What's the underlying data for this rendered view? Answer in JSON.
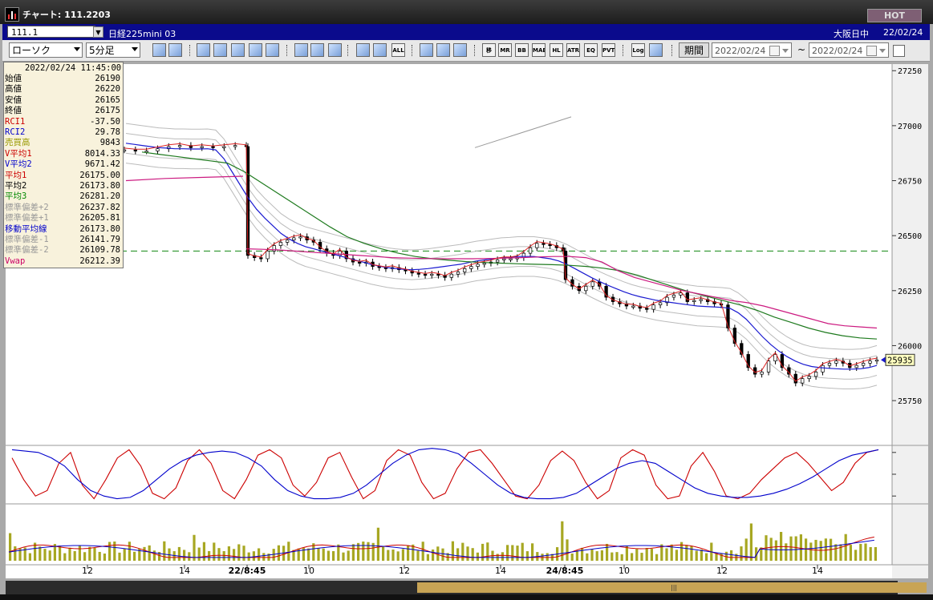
{
  "window": {
    "title": "チャート: 111.2203",
    "hot": "HOT"
  },
  "topbar": {
    "symbol_code": "111.1",
    "symbol_name": "日経225mini 03",
    "exchange": "大阪日中",
    "date": "22/02/24"
  },
  "toolbar": {
    "chart_type": "ローソク",
    "interval": "5分足",
    "period_label": "期間",
    "date_from": "2022/02/24",
    "date_to": "2022/02/24",
    "range_sep": "~",
    "buttons": [
      {
        "name": "zoom-button",
        "text": ""
      },
      {
        "name": "split-button",
        "text": ""
      },
      {
        "name": "arrow-down-button",
        "text": ""
      },
      {
        "name": "zoom-in-button",
        "text": ""
      },
      {
        "name": "bar-scale-button",
        "text": ""
      },
      {
        "name": "flip-button",
        "text": ""
      },
      {
        "name": "info-button",
        "text": ""
      },
      {
        "name": "pencil-button",
        "text": ""
      },
      {
        "name": "cursor-button",
        "text": ""
      },
      {
        "name": "undo-button",
        "text": ""
      },
      {
        "name": "candle-button",
        "text": ""
      },
      {
        "name": "candle-alt-button",
        "text": ""
      },
      {
        "name": "all-button",
        "text": "ALL"
      },
      {
        "name": "settings-button",
        "text": ""
      },
      {
        "name": "tool-button",
        "text": ""
      },
      {
        "name": "color-button",
        "text": ""
      },
      {
        "name": "ma-button",
        "text": "移"
      },
      {
        "name": "mr-button",
        "text": "MR"
      },
      {
        "name": "bb-button",
        "text": "BB"
      },
      {
        "name": "mae-button",
        "text": "MAE"
      },
      {
        "name": "hl-button",
        "text": "HL"
      },
      {
        "name": "atr-button",
        "text": "ATR"
      },
      {
        "name": "eq-button",
        "text": "EQ"
      },
      {
        "name": "pvt-button",
        "text": "PVT"
      },
      {
        "name": "log-button",
        "text": "Log"
      },
      {
        "name": "export-button",
        "text": ""
      }
    ]
  },
  "info_panel": {
    "datetime": "2022/02/24 11:45:00",
    "rows": [
      {
        "label": "始値",
        "value": "26190",
        "color": "#000000"
      },
      {
        "label": "高値",
        "value": "26220",
        "color": "#000000"
      },
      {
        "label": "安値",
        "value": "26165",
        "color": "#000000"
      },
      {
        "label": "終値",
        "value": "26175",
        "color": "#000000"
      },
      {
        "label": "RCI1",
        "value": "-37.50",
        "color": "#cc0000"
      },
      {
        "label": "RCI2",
        "value": "29.78",
        "color": "#0000cc"
      },
      {
        "label": "売買高",
        "value": "9843",
        "color": "#999900"
      },
      {
        "label": "V平均1",
        "value": "8014.33",
        "color": "#cc0000"
      },
      {
        "label": "V平均2",
        "value": "9671.42",
        "color": "#0000cc"
      },
      {
        "label": "平均1",
        "value": "26175.00",
        "color": "#cc0000"
      },
      {
        "label": "平均2",
        "value": "26173.80",
        "color": "#000000"
      },
      {
        "label": "平均3",
        "value": "26281.20",
        "color": "#008800"
      },
      {
        "label": "標準偏差+2",
        "value": "26237.82",
        "color": "#999999"
      },
      {
        "label": "標準偏差+1",
        "value": "26205.81",
        "color": "#999999"
      },
      {
        "label": "移動平均線",
        "value": "26173.80",
        "color": "#0000cc"
      },
      {
        "label": "標準偏差-1",
        "value": "26141.79",
        "color": "#999999"
      },
      {
        "label": "標準偏差-2",
        "value": "26109.78",
        "color": "#999999"
      },
      {
        "label": "Vwap",
        "value": "26212.39",
        "color": "#cc0066"
      }
    ]
  },
  "chart_data": {
    "type": "candlestick",
    "price_axis": {
      "ticks": [
        27250,
        27000,
        26750,
        26500,
        26250,
        26000,
        25750
      ],
      "ylim": [
        25550,
        27280
      ]
    },
    "x_ticks": [
      "12",
      "14",
      "22/8:45",
      "10",
      "12",
      "14",
      "24/8:45",
      "10",
      "12",
      "14"
    ],
    "current_price": "25935",
    "dashed_line": 26430,
    "trendline": [
      [
        26900,
        26945
      ],
      [
        27040,
        27200
      ]
    ],
    "candles_close": [
      26890,
      26885,
      26885,
      26895,
      26905,
      26910,
      26900,
      26905,
      26900,
      26905,
      26910,
      26905,
      26410,
      26400,
      26395,
      26430,
      26455,
      26470,
      26480,
      26490,
      26495,
      26480,
      26470,
      26440,
      26420,
      26410,
      26430,
      26395,
      26380,
      26375,
      26380,
      26360,
      26355,
      26350,
      26355,
      26345,
      26340,
      26330,
      26325,
      26320,
      26325,
      26320,
      26310,
      26325,
      26335,
      26350,
      26360,
      26370,
      26375,
      26380,
      26390,
      26395,
      26395,
      26400,
      26420,
      26445,
      26465,
      26460,
      26455,
      26445,
      26430,
      26300,
      26270,
      26250,
      26270,
      26290,
      26270,
      26220,
      26200,
      26190,
      26180,
      26180,
      26170,
      26165,
      26185,
      26195,
      26220,
      26230,
      26240,
      26200,
      26205,
      26210,
      26200,
      26190,
      26185,
      26080,
      26010,
      25960,
      25900,
      25870,
      25880,
      25930,
      25960,
      25900,
      25870,
      25830,
      25850,
      25860,
      25880,
      25910,
      25920,
      25930,
      25920,
      25900,
      25910,
      25920,
      25930,
      25935
    ],
    "ma_blue": [
      26920,
      26915,
      26910,
      26905,
      26900,
      26898,
      26895,
      26895,
      26894,
      26894,
      26895,
      26890,
      26850,
      26790,
      26730,
      26670,
      26620,
      26580,
      26545,
      26510,
      26485,
      26465,
      26450,
      26440,
      26430,
      26420,
      26410,
      26400,
      26390,
      26380,
      26370,
      26362,
      26355,
      26350,
      26347,
      26345,
      26347,
      26350,
      26355,
      26360,
      26365,
      26370,
      26378,
      26385,
      26390,
      26395,
      26400,
      26402,
      26405,
      26405,
      26405,
      26400,
      26395,
      26385,
      26370,
      26350,
      26330,
      26310,
      26292,
      26275,
      26260,
      26245,
      26232,
      26222,
      26214,
      26206,
      26200,
      26195,
      26190,
      26185,
      26180,
      26178,
      26176,
      26174,
      26170,
      26150,
      26120,
      26080,
      26040,
      26005,
      25975,
      25950,
      25930,
      25915,
      25905,
      25900,
      25897,
      25895,
      25893,
      25893,
      25895,
      25900,
      25910
    ],
    "ma_green": [
      26880,
      26870,
      26860,
      26850,
      26840,
      26830,
      26790,
      26740,
      26690,
      26640,
      26590,
      26540,
      26495,
      26465,
      26440,
      26420,
      26405,
      26395,
      26388,
      26382,
      26378,
      26375,
      26372,
      26370,
      26368,
      26365,
      26360,
      26352,
      26340,
      26320,
      26295,
      26270,
      26245,
      26225,
      26205,
      26185,
      26160,
      26130,
      26105,
      26080,
      26060,
      26045,
      26035,
      26030
    ],
    "ma_magenta_pre": [
      26750,
      26760,
      26765,
      26770
    ],
    "ma_magenta": [
      26440,
      26438,
      26435,
      26430,
      26425,
      26420,
      26415,
      26410,
      26405,
      26400,
      26398,
      26396,
      26395,
      26395,
      26395,
      26396,
      26398,
      26400,
      26403,
      26405,
      26405,
      26400,
      26380,
      26340,
      26310,
      26290,
      26270,
      26250,
      26235,
      26220,
      26205,
      26195,
      26180,
      26160,
      26140,
      26120,
      26100,
      26090,
      26085,
      26080
    ],
    "rci_red": [
      60,
      -20,
      -80,
      -60,
      40,
      80,
      -40,
      -90,
      -20,
      60,
      90,
      30,
      -70,
      -90,
      -50,
      50,
      90,
      40,
      -60,
      -90,
      -20,
      70,
      90,
      60,
      -40,
      -80,
      -30,
      60,
      80,
      -10,
      -90,
      -60,
      50,
      90,
      70,
      -30,
      -90,
      -70,
      20,
      80,
      90,
      40,
      -20,
      -80,
      -90,
      -40,
      50,
      85,
      50,
      -30,
      -90,
      -60,
      60,
      90,
      70,
      -40,
      -90,
      -80,
      30,
      80,
      10,
      -80,
      -90,
      -70,
      -20,
      20,
      60,
      80,
      40,
      -10,
      -60,
      -30,
      40,
      80,
      90
    ],
    "rci_blue": [
      90,
      85,
      80,
      60,
      30,
      -20,
      -60,
      -80,
      -90,
      -85,
      -60,
      -20,
      20,
      50,
      70,
      80,
      85,
      80,
      60,
      30,
      -20,
      -60,
      -80,
      -90,
      -90,
      -85,
      -70,
      -40,
      0,
      40,
      70,
      90,
      95,
      90,
      75,
      40,
      0,
      -40,
      -70,
      -85,
      -90,
      -90,
      -85,
      -70,
      -40,
      -10,
      20,
      40,
      50,
      40,
      10,
      -20,
      -50,
      -70,
      -80,
      -85,
      -85,
      -80,
      -70,
      -55,
      -35,
      -10,
      20,
      50,
      70,
      80,
      90
    ]
  }
}
